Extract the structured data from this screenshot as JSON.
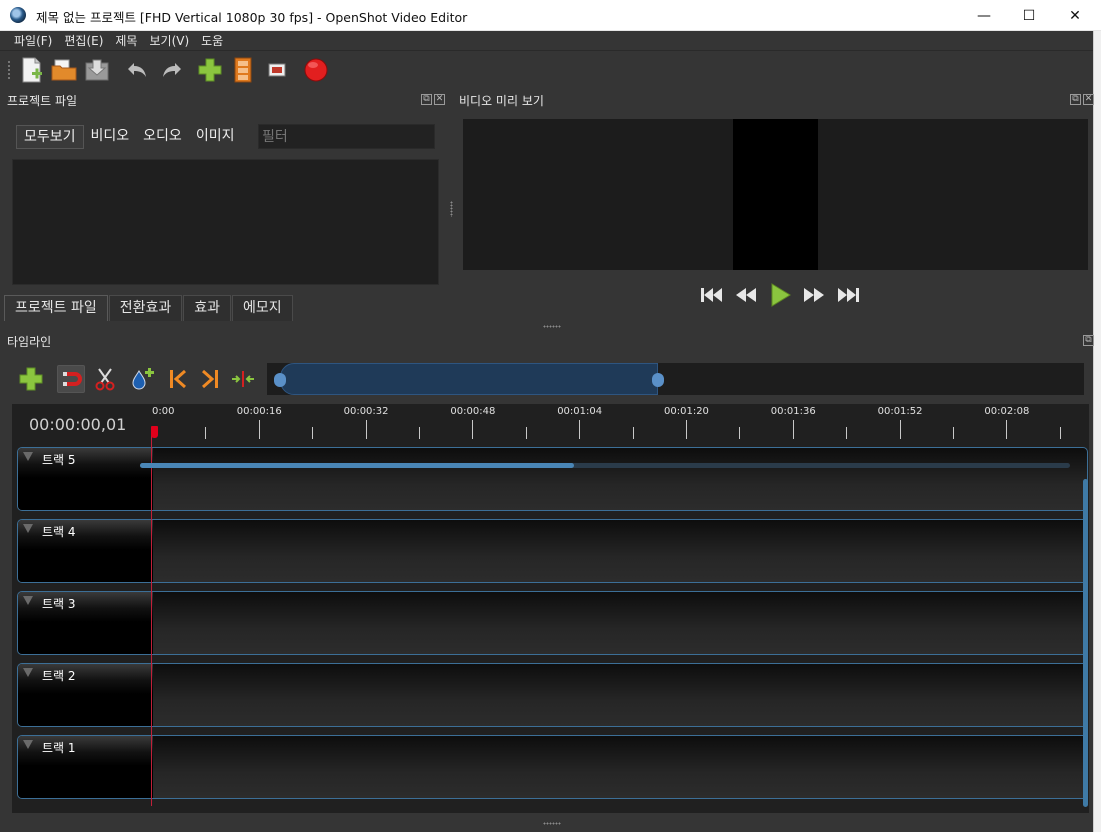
{
  "window": {
    "title": "제목 없는 프로젝트 [FHD Vertical 1080p 30 fps] - OpenShot Video Editor",
    "minimize_glyph": "—",
    "maximize_glyph": "☐",
    "close_glyph": "✕"
  },
  "menu": {
    "items": [
      "파일(F)",
      "편집(E)",
      "제목",
      "보기(V)",
      "도움"
    ]
  },
  "toolbar": {
    "icons": [
      "new-project-icon",
      "open-project-icon",
      "save-project-icon",
      "undo-icon",
      "redo-icon",
      "import-files-icon",
      "choose-profile-icon",
      "fullscreen-icon",
      "export-video-icon"
    ]
  },
  "project_files": {
    "title": "프로젝트 파일",
    "filters": [
      "모두보기",
      "비디오",
      "오디오",
      "이미지"
    ],
    "active_filter": "모두보기",
    "filter_placeholder": "필터",
    "tabs": [
      "프로젝트 파일",
      "전환효과",
      "효과",
      "에모지"
    ],
    "active_tab": "프로젝트 파일"
  },
  "video_preview": {
    "title": "비디오 미리 보기",
    "controls": [
      "jump-start-icon",
      "rewind-icon",
      "play-icon",
      "fast-forward-icon",
      "jump-end-icon"
    ]
  },
  "timeline": {
    "title": "타임라인",
    "current_time": "00:00:00,01",
    "ruler_labels": [
      "0:00",
      "00:00:16",
      "00:00:32",
      "00:00:48",
      "00:01:04",
      "00:01:20",
      "00:01:36",
      "00:01:52",
      "00:02:08"
    ],
    "tracks": [
      "트랙 5",
      "트랙 4",
      "트랙 3",
      "트랙 2",
      "트랙 1"
    ],
    "tool_icons": [
      "add-track-icon",
      "snapping-icon",
      "razor-icon",
      "add-marker-icon",
      "previous-marker-icon",
      "next-marker-icon",
      "center-playhead-icon"
    ]
  },
  "colors": {
    "background": "#353535",
    "accent_blue": "#3c6f97",
    "playhead_red": "#e0001b",
    "add_green": "#8bc53f",
    "record_red": "#e21f1f"
  }
}
